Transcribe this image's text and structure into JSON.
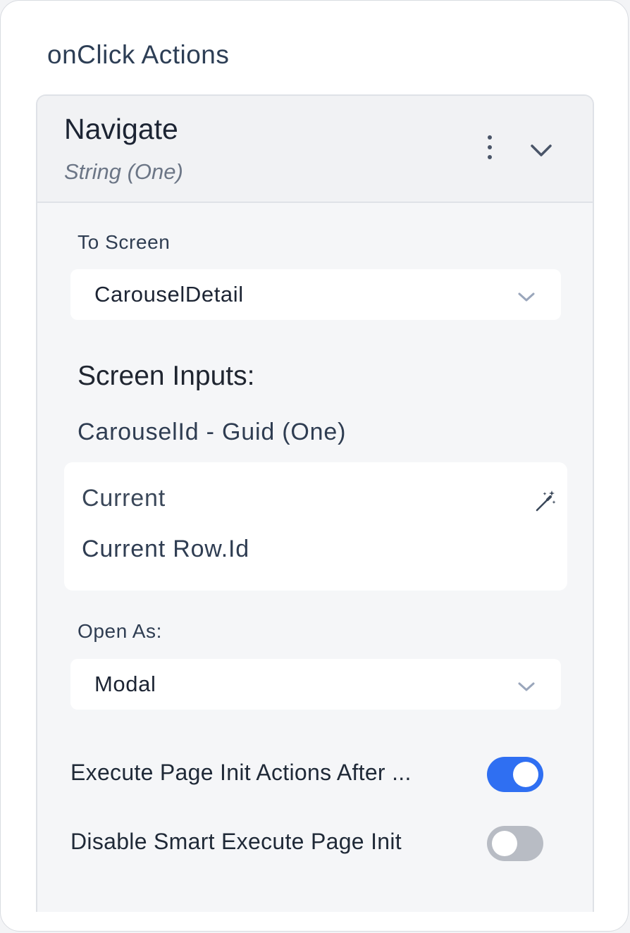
{
  "section": {
    "title": "onClick Actions"
  },
  "action": {
    "name": "Navigate",
    "type": "String (One)",
    "menu_icon": "kebab-icon",
    "collapse_icon": "chevron-down-icon"
  },
  "to_screen": {
    "label": "To Screen",
    "value": "CarouselDetail"
  },
  "screen_inputs": {
    "title": "Screen Inputs:",
    "param_label": "CarouselId - Guid (One)",
    "source": "Current",
    "expression": "Current Row.Id",
    "binding_icon": "magic-wand-icon"
  },
  "open_as": {
    "label": "Open As:",
    "value": "Modal"
  },
  "toggles": [
    {
      "label": "Execute Page Init Actions After ...",
      "checked": true
    },
    {
      "label": "Disable Smart Execute Page Init",
      "checked": false
    }
  ],
  "colors": {
    "accent": "#2f6ff2",
    "toggle_off": "#b8bcc4",
    "card_bg": "#f5f6f8"
  }
}
